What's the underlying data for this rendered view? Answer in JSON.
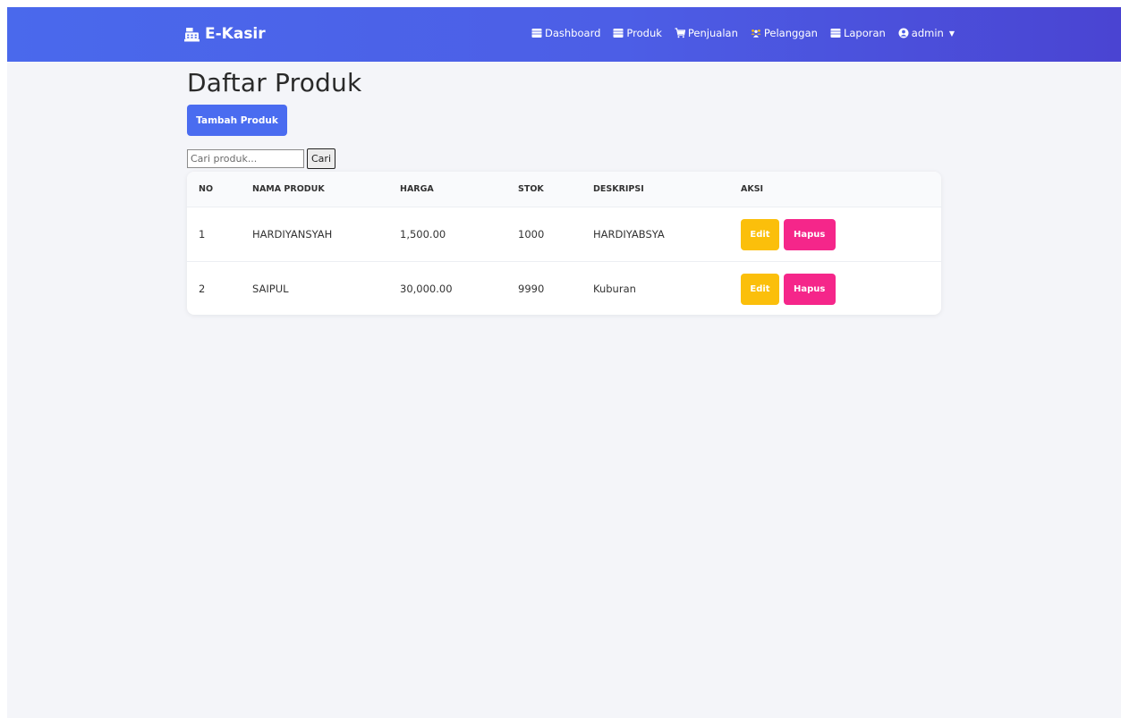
{
  "navbar": {
    "brand": "E-Kasir",
    "brand_icon": "cash-register-icon",
    "items": [
      {
        "label": "Dashboard",
        "icon": "table-icon"
      },
      {
        "label": "Produk",
        "icon": "table-icon"
      },
      {
        "label": "Penjualan",
        "icon": "cart-icon"
      },
      {
        "label": "Pelanggan",
        "icon": "users-icon"
      },
      {
        "label": "Laporan",
        "icon": "table-icon"
      }
    ],
    "user": {
      "label": "admin",
      "icon": "user-circle-icon"
    }
  },
  "page": {
    "title": "Daftar Produk",
    "add_button": "Tambah Produk"
  },
  "search": {
    "placeholder": "Cari produk...",
    "button": "Cari"
  },
  "table": {
    "headers": [
      "NO",
      "NAMA PRODUK",
      "HARGA",
      "STOK",
      "DESKRIPSI",
      "AKSI"
    ],
    "rows": [
      {
        "no": "1",
        "name": "HARDIYANSYAH",
        "price": "1,500.00",
        "stock": "1000",
        "desc": "HARDIYABSYA",
        "edit": "Edit",
        "delete": "Hapus"
      },
      {
        "no": "2",
        "name": "SAIPUL",
        "price": "30,000.00",
        "stock": "9990",
        "desc": "Kuburan",
        "edit": "Edit",
        "delete": "Hapus"
      }
    ]
  },
  "colors": {
    "navbar_start": "#4a69ec",
    "navbar_end": "#4a44d2",
    "primary": "#4a6cf0",
    "edit": "#fbbf0b",
    "delete": "#f5268a",
    "background": "#f4f5f9"
  }
}
